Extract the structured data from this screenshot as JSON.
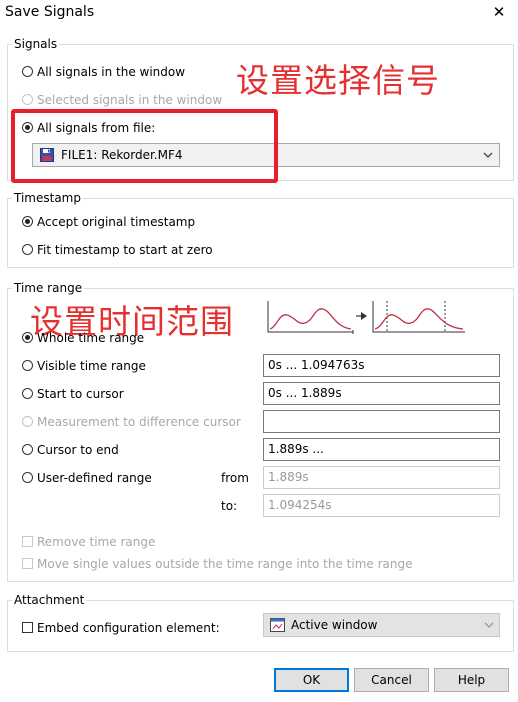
{
  "window": {
    "title": "Save Signals",
    "close_glyph": "✕"
  },
  "signals": {
    "legend": "Signals",
    "opt_window": "All signals in the window",
    "opt_selected": "Selected signals in the window",
    "opt_file": "All signals from file:",
    "file_value": "FILE1: Rekorder.MF4",
    "annotation": "设置选择信号",
    "highlight_color": "#e5202a"
  },
  "timestamp": {
    "legend": "Timestamp",
    "opt_accept": "Accept original timestamp",
    "opt_fit": "Fit timestamp to start at zero"
  },
  "timerange": {
    "legend": "Time range",
    "annotation": "设置时间范围",
    "opt_whole": "Whole time range",
    "opt_visible": "Visible time range",
    "visible_value": "0s  ...  1.094763s",
    "opt_start_cursor": "Start to cursor",
    "start_cursor_value": "0s  ...  1.889s",
    "opt_measurement": "Measurement to difference cursor",
    "measurement_value": "",
    "opt_cursor_end": "Cursor to end",
    "cursor_end_value": "1.889s  ...",
    "opt_user": "User-defined range",
    "from_label": "from",
    "from_value": "1.889s",
    "to_label": "to:",
    "to_value": "1.094254s",
    "chk_remove": "Remove time range",
    "chk_move": "Move single values outside the time range into the time range"
  },
  "attachment": {
    "legend": "Attachment",
    "chk_embed": "Embed configuration element:",
    "select_value": "Active window"
  },
  "buttons": {
    "ok": "OK",
    "cancel": "Cancel",
    "help": "Help"
  }
}
